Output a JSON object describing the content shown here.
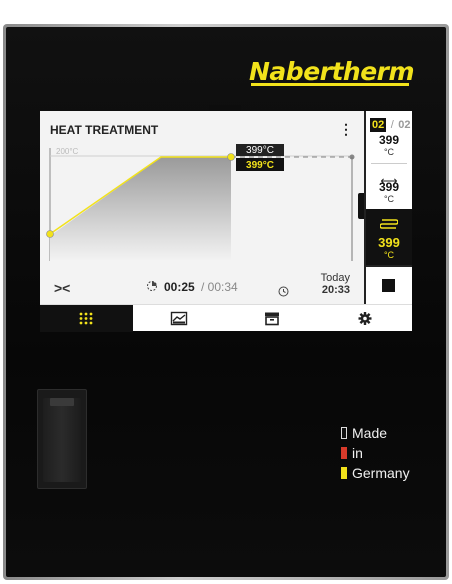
{
  "brand": {
    "name": "Nabertherm",
    "color": "#f2e21b"
  },
  "screen": {
    "program_title": "HEAT TREATMENT",
    "menu_icon": "kebab-menu-icon",
    "chart_data": {
      "type": "line",
      "title": "",
      "ylabel_tick": "200°C",
      "series": [
        {
          "name": "",
          "points_description": "ramp then hold",
          "values": [
            200,
            399,
            399,
            399
          ]
        }
      ],
      "setpoint_label": "399°C",
      "actual_label": "399°C",
      "grid": false
    },
    "controls": {
      "collapse_symbol": "><",
      "elapsed": "00:25",
      "total": "/ 00:34",
      "end_label_day": "Today",
      "end_label_time": "20:33"
    },
    "side": {
      "segment_current": "02",
      "segment_sep": "/",
      "segment_total": "02",
      "setpoint_temp": "399",
      "setpoint_unit": "°C",
      "arrow_symbol": "⟷",
      "target_temp": "399",
      "target_unit": "°C",
      "heating_temp": "399",
      "heating_unit": "°C"
    },
    "nav": [
      {
        "name": "dashboard",
        "icon": "grid-dots-icon",
        "active": true
      },
      {
        "name": "programs",
        "icon": "chart-icon",
        "active": false
      },
      {
        "name": "archive",
        "icon": "archive-icon",
        "active": false
      },
      {
        "name": "settings",
        "icon": "gear-icon",
        "active": false
      }
    ]
  },
  "made_in": {
    "line1": "Made",
    "line2": "in",
    "line3": "Germany",
    "colors": [
      "#111111",
      "#d83a2a",
      "#f2e21b"
    ]
  }
}
